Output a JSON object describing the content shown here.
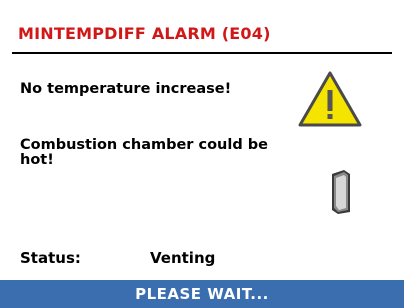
{
  "alarm": {
    "title": "MINTEMPDIFF ALARM (E04)",
    "message_1": "No temperature increase!",
    "message_2": "Combustion chamber could be hot!",
    "status_label": "Status:",
    "status_value": "Venting",
    "footer": "PLEASE WAIT...",
    "warning_icon": "warning-triangle-icon",
    "door_icon": "chamber-door-icon"
  },
  "colors": {
    "title": "#d01818",
    "footer_bg": "#3a6eaf",
    "warning_fill": "#f4e400"
  }
}
